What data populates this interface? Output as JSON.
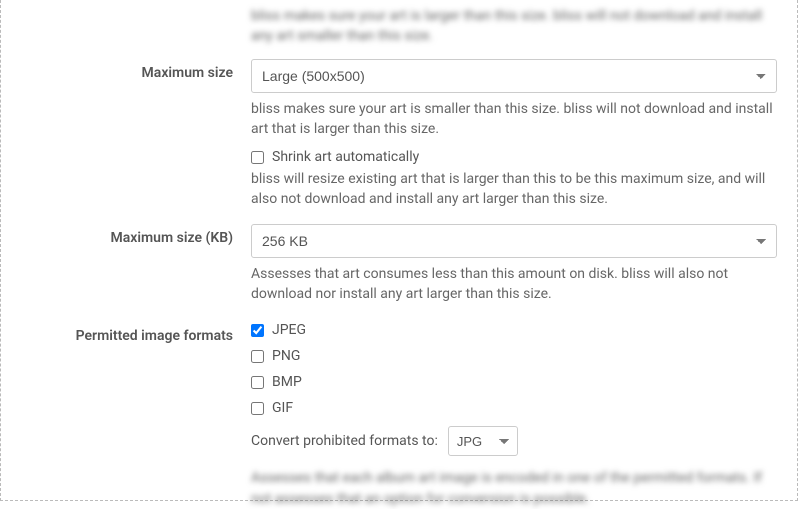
{
  "topBlur": "bliss makes sure your art is larger than this size. bliss will not download and install any art smaller than this size.",
  "maxSize": {
    "label": "Maximum size",
    "value": "Large (500x500)",
    "help": "bliss makes sure your art is smaller than this size. bliss will not download and install art that is larger than this size.",
    "shrinkLabel": "Shrink art automatically",
    "shrinkHelp": "bliss will resize existing art that is larger than this to be this maximum size, and will also not download and install any art larger than this size."
  },
  "maxSizeKb": {
    "label": "Maximum size (KB)",
    "value": "256 KB",
    "help": "Assesses that art consumes less than this amount on disk. bliss will also not download nor install any art larger than this size."
  },
  "permitted": {
    "label": "Permitted image formats",
    "jpeg": "JPEG",
    "png": "PNG",
    "bmp": "BMP",
    "gif": "GIF",
    "convertLabel": "Convert prohibited formats to:",
    "convertValue": "JPG"
  },
  "bottomBlur": "Assesses that each album art image is encoded in one of the permitted formats. If not assesses that an option for conversion is possible."
}
